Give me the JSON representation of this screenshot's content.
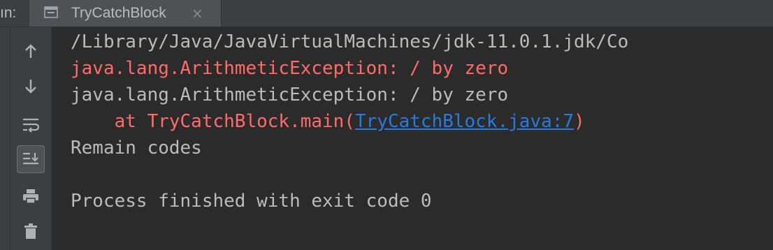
{
  "run_label": "ın:",
  "tab": {
    "title": "TryCatchBlock",
    "close": "×"
  },
  "toolbar": {
    "buttons": [
      {
        "name": "up-arrow-icon"
      },
      {
        "name": "down-arrow-icon"
      },
      {
        "name": "soft-wrap-icon"
      },
      {
        "name": "scroll-to-end-icon",
        "active": true
      },
      {
        "name": "print-icon"
      },
      {
        "name": "trash-icon"
      }
    ]
  },
  "console": {
    "line1": "/Library/Java/JavaVirtualMachines/jdk-11.0.1.jdk/Co",
    "line2": "java.lang.ArithmeticException: / by zero",
    "line3": "java.lang.ArithmeticException: / by zero",
    "line4_prefix": "    at TryCatchBlock.main(",
    "line4_link": "TryCatchBlock.java:7",
    "line4_suffix": ")",
    "line5": "Remain codes",
    "line6": "",
    "line7": "Process finished with exit code 0"
  },
  "colors": {
    "background": "#2b2b2b",
    "panel": "#3c3f41",
    "text": "#bbbbbb",
    "error": "#ff6b68",
    "link": "#287bde"
  }
}
